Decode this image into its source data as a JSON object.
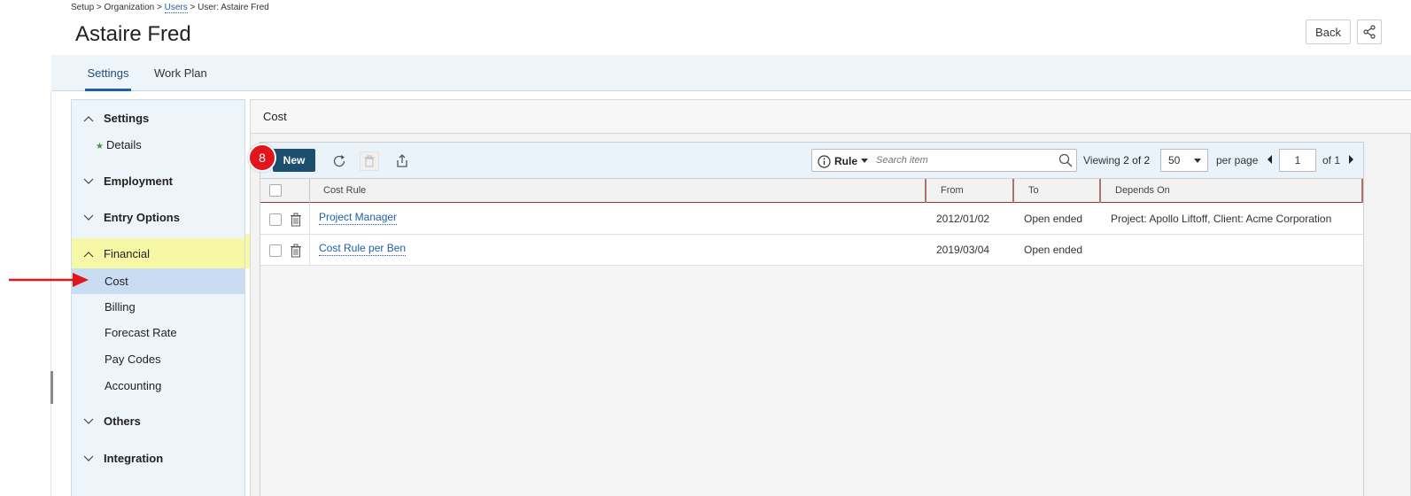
{
  "breadcrumb": {
    "part1": "Setup > Organization > ",
    "link": "Users",
    "part2": " > User: Astaire Fred"
  },
  "page_title": "Astaire Fred",
  "header": {
    "back_label": "Back"
  },
  "tabs": [
    {
      "label": "Settings",
      "active": true
    },
    {
      "label": "Work Plan",
      "active": false
    }
  ],
  "sidebar": {
    "settings": "Settings",
    "details": "Details",
    "employment": "Employment",
    "entry_options": "Entry Options",
    "financial": "Financial",
    "cost": "Cost",
    "billing": "Billing",
    "forecast_rate": "Forecast Rate",
    "pay_codes": "Pay Codes",
    "accounting": "Accounting",
    "others": "Others",
    "integration": "Integration"
  },
  "panel": {
    "title": "Cost"
  },
  "toolbar": {
    "new_label": "New",
    "badge": "8",
    "rule_label": "Rule",
    "search_placeholder": "Search item",
    "viewing_label": "Viewing",
    "viewing_count": "2 of 2",
    "per_page_value": "50",
    "per_page_label": "per page",
    "page_value": "1",
    "page_of": "of 1"
  },
  "table": {
    "columns": [
      "Cost Rule",
      "From",
      "To",
      "Depends On"
    ],
    "rows": [
      {
        "cost_rule": "Project Manager",
        "from": "2012/01/02",
        "to": "Open ended",
        "depends_on": "Project: Apollo Liftoff, Client: Acme Corporation"
      },
      {
        "cost_rule": "Cost Rule per Ben",
        "from": "2019/03/04",
        "to": "Open ended",
        "depends_on": ""
      }
    ]
  },
  "colors": {
    "accent": "#1f5fa8",
    "new_button": "#1d4e6e",
    "badge": "#e0161c",
    "highlight": "#f7f9a8",
    "selected": "#c8ddf2"
  }
}
